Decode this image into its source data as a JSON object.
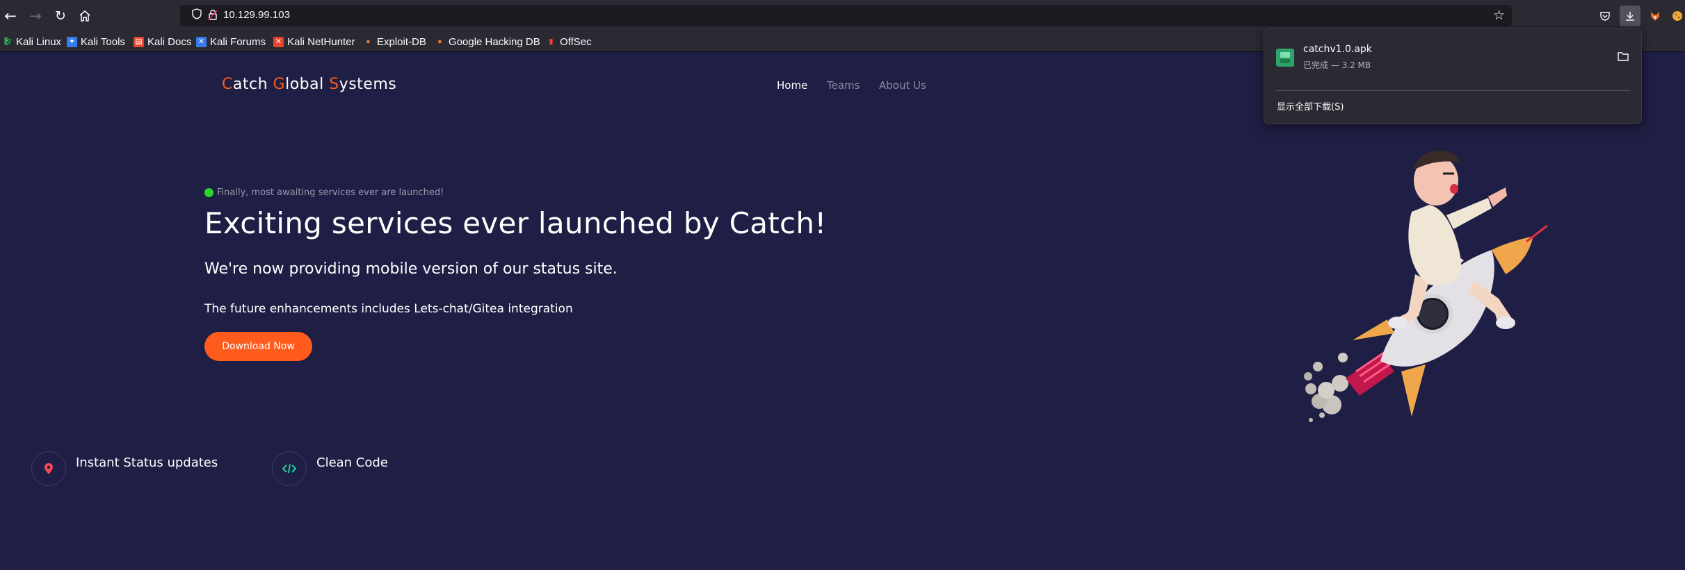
{
  "browser": {
    "url": "10.129.99.103",
    "downloads_panel": {
      "filename": "catchv1.0.apk",
      "status": "已完成 — 3.2 MB",
      "show_all": "显示全部下载(S)"
    }
  },
  "bookmarks": [
    {
      "label": "Kali Linux",
      "icon": "kali-icon",
      "color": "#367bf0"
    },
    {
      "label": "Kali Tools",
      "icon": "kali-tools-icon",
      "color": "#367bf0"
    },
    {
      "label": "Kali Docs",
      "icon": "kali-docs-icon",
      "color": "#e8442e"
    },
    {
      "label": "Kali Forums",
      "icon": "kali-forums-icon",
      "color": "#367bf0"
    },
    {
      "label": "Kali NetHunter",
      "icon": "nethunter-icon",
      "color": "#e8442e"
    },
    {
      "label": "Exploit-DB",
      "icon": "exploitdb-icon",
      "color": "#e67a2e"
    },
    {
      "label": "Google Hacking DB",
      "icon": "ghdb-icon",
      "color": "#e67a2e"
    },
    {
      "label": "OffSec",
      "icon": "offsec-icon",
      "color": "#e8442e"
    }
  ],
  "site": {
    "logo": {
      "c": "C",
      "atch": "atch ",
      "g": "G",
      "lobal": "lobal ",
      "s": "S",
      "ystems": "ystems"
    },
    "menu": [
      "Home",
      "Teams",
      "About Us"
    ],
    "tagline": "Finally, most awaiting services ever are launched!",
    "title": "Exciting services ever launched by Catch!",
    "subtitle": "We're now providing mobile version of our status site.",
    "subtitle2": "The future enhancements includes Lets-chat/Gitea integration",
    "cta": "Download Now",
    "features": [
      {
        "label": "Instant Status updates",
        "icon": "location-pin-icon"
      },
      {
        "label": "Clean Code",
        "icon": "code-icon"
      }
    ],
    "accent": "#fe5b1c",
    "background": "#1f1e44"
  }
}
